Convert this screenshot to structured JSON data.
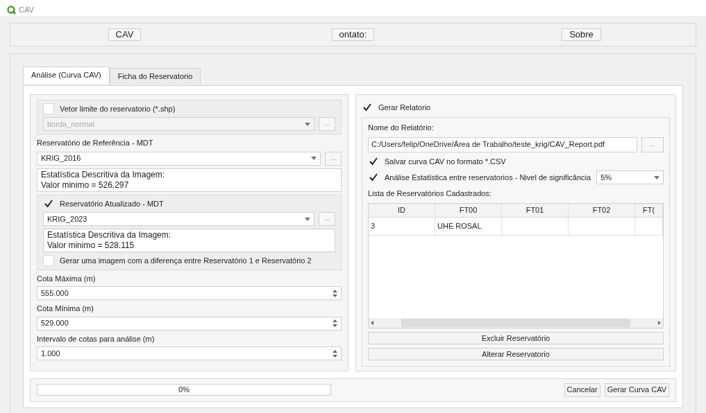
{
  "window": {
    "title": "CAV"
  },
  "top_buttons": [
    "CAV",
    "ontato:",
    "Sobre"
  ],
  "tabs": [
    {
      "label": "Análise (Curva CAV)",
      "selected": true
    },
    {
      "label": "Ficha do Reservatorio",
      "selected": false
    }
  ],
  "left": {
    "vector": {
      "label": "Vetor limite do reservatorio (*.shp)",
      "checked": false,
      "combo": "borda_normal",
      "browse": "..."
    },
    "reference": {
      "label": "Reservatório de Referência - MDT",
      "combo": "KRIG_2016",
      "browse": "...",
      "stats": [
        "Estatística Descritiva da Imagem:",
        "Valor minimo = 526.297"
      ]
    },
    "updated": {
      "label": "Reservatório Atualizado - MDT",
      "checked": true,
      "combo": "KRIG_2023",
      "browse": "...",
      "stats": [
        "Estatística Descritiva da Imagem:",
        "Valor minimo = 528.115"
      ]
    },
    "difference": {
      "label": "Gerar uma imagem com a diferença entre Reservatório 1 e Reservatório 2",
      "checked": false
    },
    "spinboxes": [
      {
        "label": "Cota Máxima (m)",
        "value": "555.000"
      },
      {
        "label": "Cota Mínima (m)",
        "value": "529.000"
      },
      {
        "label": "Intervalo de cotas para análise (m)",
        "value": "1.000"
      }
    ]
  },
  "right": {
    "report": {
      "label": "Gerar Relatorio",
      "checked": true
    },
    "name_label": "Nome do Relatório:",
    "path": "C:/Users/felip/OneDrive/Área de Trabalho/teste_krig/CAV_Report.pdf",
    "browse": "...",
    "csv": {
      "label": "Salvar curva CAV no formato *.CSV",
      "checked": true
    },
    "stats": {
      "label": "Análise Estatística entre reservatorios - Nivel de significância",
      "checked": true,
      "combo": "5%"
    },
    "list_label": "Lista de Reservatórios Cadastrados:",
    "table": {
      "columns": [
        "ID",
        "FT00",
        "FT01",
        "FT02",
        "FT("
      ],
      "rows": [
        [
          "3",
          "UHE ROSAL"
        ]
      ]
    },
    "buttons": [
      "Excluir Reservatório",
      "Alterar Reservatorio"
    ]
  },
  "progress": {
    "text": "0%",
    "level": 0
  },
  "bottom_buttons": [
    "Cancelar",
    "Gerar Curva CAV"
  ]
}
